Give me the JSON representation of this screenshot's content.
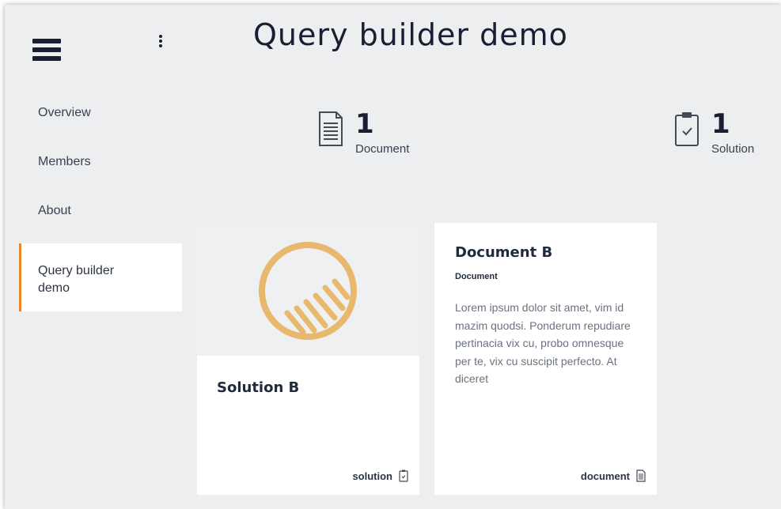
{
  "header": {
    "title": "Query builder demo",
    "menu_icon": "hamburger-menu-icon",
    "more_icon": "more-vertical-icon"
  },
  "sidebar": {
    "items": [
      {
        "label": "Overview",
        "active": false
      },
      {
        "label": "Members",
        "active": false
      },
      {
        "label": "About",
        "active": false
      },
      {
        "label": "Query builder demo",
        "active": true
      }
    ]
  },
  "stats": {
    "documents": {
      "count": "1",
      "label": "Document",
      "icon": "document-icon"
    },
    "solutions": {
      "count": "1",
      "label": "Solution",
      "icon": "clipboard-check-icon"
    }
  },
  "cards": {
    "solution": {
      "title": "Solution B",
      "type_label": "solution",
      "thumbnail_icon": "solution-logo-icon",
      "type_icon": "clipboard-check-icon"
    },
    "document": {
      "title": "Document B",
      "type": "Document",
      "description": "Lorem ipsum dolor sit amet, vim id mazim quodsi. Ponderum repudiare pertinacia vix cu, probo omnesque per te, vix cu suscipit perfecto. At diceret",
      "type_label": "document",
      "type_icon": "document-icon"
    }
  },
  "colors": {
    "accent": "#e8862d",
    "logo": "#e8b86d",
    "navy": "#1b1d33",
    "background": "#eceef0"
  }
}
